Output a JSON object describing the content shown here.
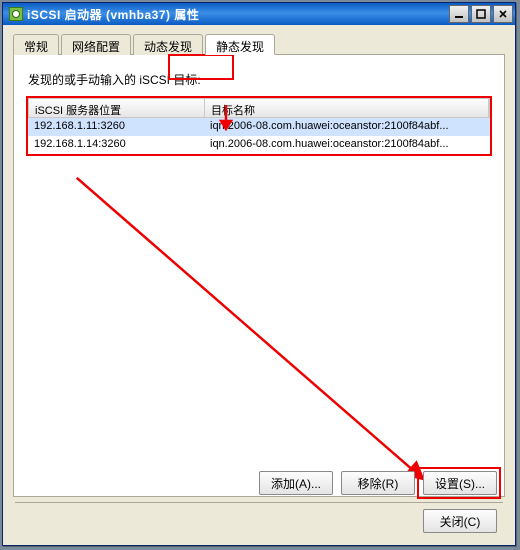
{
  "window": {
    "title": "iSCSI 启动器 (vmhba37) 属性"
  },
  "tabs": {
    "general": "常规",
    "network": "网络配置",
    "dynamic": "动态发现",
    "static": "静态发现",
    "active": "static"
  },
  "panel": {
    "label": "发现的或手动输入的 iSCSI 目标:",
    "columns": {
      "server": "iSCSI 服务器位置",
      "target": "目标名称"
    },
    "rows": [
      {
        "server": "192.168.1.11:3260",
        "target": "iqn.2006-08.com.huawei:oceanstor:2100f84abf..."
      },
      {
        "server": "192.168.1.14:3260",
        "target": "iqn.2006-08.com.huawei:oceanstor:2100f84abf..."
      }
    ]
  },
  "buttons": {
    "add": "添加(A)...",
    "remove": "移除(R)",
    "settings": "设置(S)...",
    "close": "关闭(C)"
  },
  "colors": {
    "highlight": "#e00000",
    "selection": "#cfe3ff"
  }
}
